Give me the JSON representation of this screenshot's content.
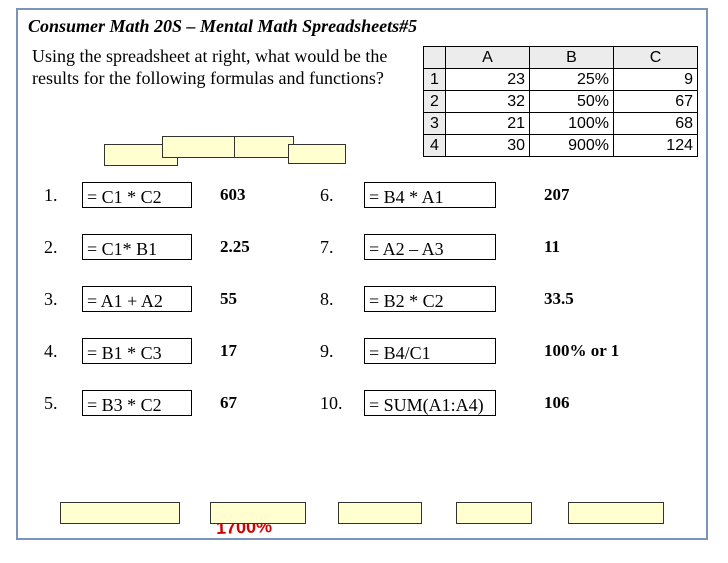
{
  "title": "Consumer Math 20S – Mental Math   Spreadsheets#5",
  "instructions": "Using the spreadsheet at right, what would be the results for the following formulas and functions?",
  "sheet": {
    "cols": [
      "A",
      "B",
      "C"
    ],
    "rows": [
      "1",
      "2",
      "3",
      "4"
    ],
    "cells": [
      [
        "23",
        "25%",
        "9"
      ],
      [
        "32",
        "50%",
        "67"
      ],
      [
        "21",
        "100%",
        "68"
      ],
      [
        "30",
        "900%",
        "124"
      ]
    ]
  },
  "questions_left": [
    {
      "n": "1.",
      "formula": "= C1 * C2",
      "answer": "603"
    },
    {
      "n": "2.",
      "formula": "= C1* B1",
      "answer": "2.25"
    },
    {
      "n": "3.",
      "formula": "= A1 + A2",
      "answer": "55"
    },
    {
      "n": "4.",
      "formula": "= B1 * C3",
      "answer": "17"
    },
    {
      "n": "5.",
      "formula": "= B3 * C2",
      "answer": "67"
    }
  ],
  "questions_right": [
    {
      "n": "6.",
      "formula": "= B4 * A1",
      "answer": "207"
    },
    {
      "n": "7.",
      "formula": "= A2 – A3",
      "answer": "11"
    },
    {
      "n": "8.",
      "formula": "= B2 * C2",
      "answer": "33.5"
    },
    {
      "n": "9.",
      "formula": "= B4/C1",
      "answer": "100% or 1"
    },
    {
      "n": "10.",
      "formula": "= SUM(A1:A4)",
      "answer": "106"
    }
  ],
  "handwritten_note": "1700%"
}
